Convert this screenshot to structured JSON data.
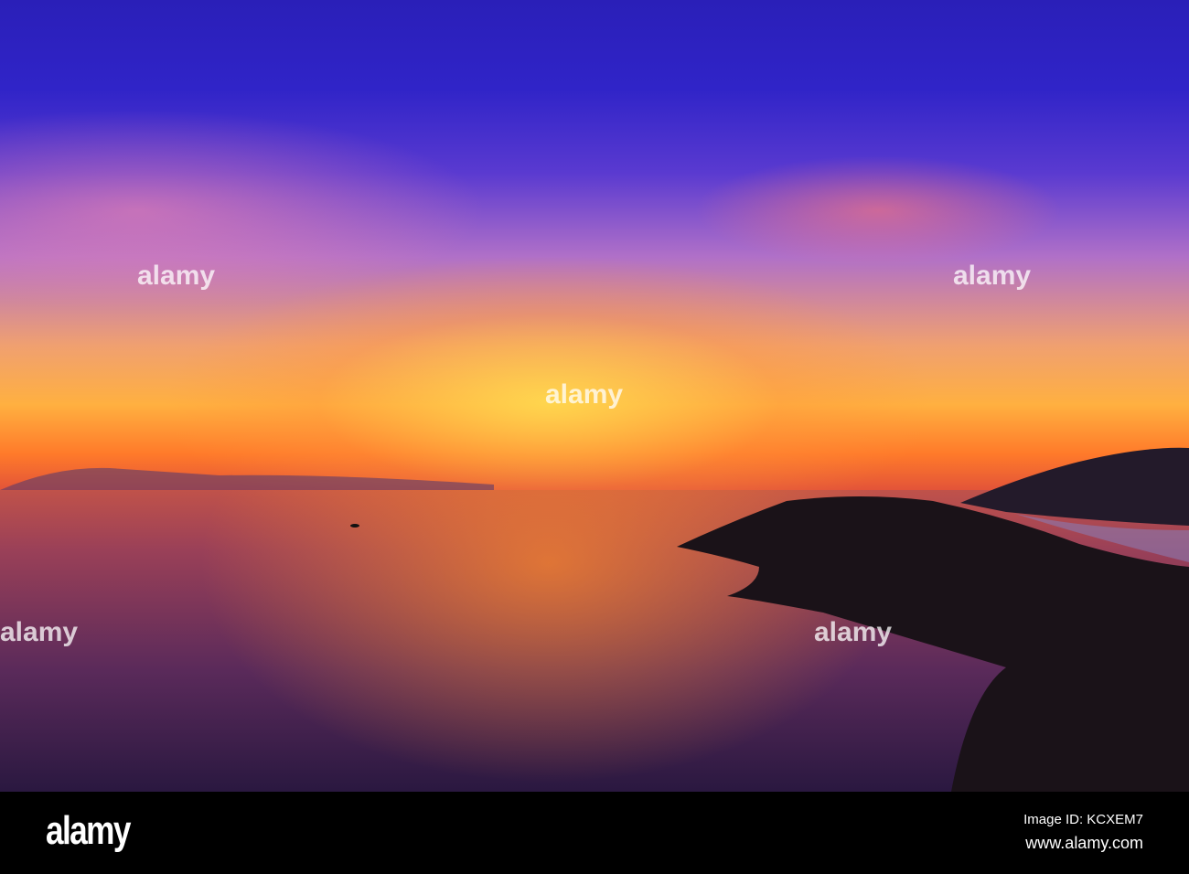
{
  "watermark": {
    "text": "alamy"
  },
  "footer": {
    "logo": "alamy",
    "image_id": "Image ID: KCXEM7",
    "website": "www.alamy.com"
  },
  "colors": {
    "sky_top": "#2a1fb8",
    "horizon": "#ff7a2a",
    "sea": "#5a2a5a",
    "footer_bg": "#000000"
  }
}
